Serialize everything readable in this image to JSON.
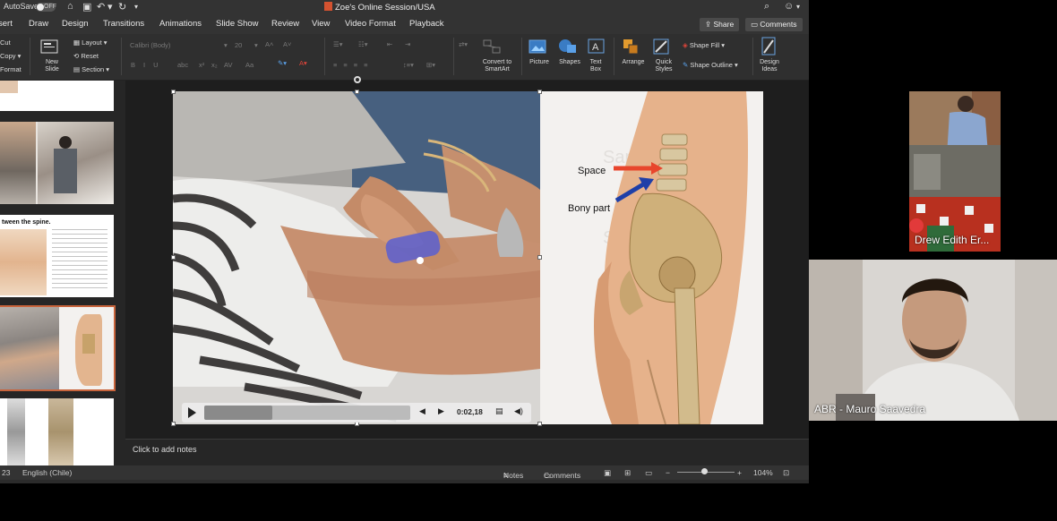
{
  "titlebar": {
    "autosave": "AutoSave",
    "toggle": "OFF",
    "document_title": "Zoe's Online Session/USA"
  },
  "tabs": [
    "sert",
    "Draw",
    "Design",
    "Transitions",
    "Animations",
    "Slide Show",
    "Review",
    "View",
    "Video Format",
    "Playback"
  ],
  "header_buttons": {
    "share": "Share",
    "comments": "Comments"
  },
  "ribbon": {
    "clipboard": {
      "cut": "Cut",
      "copy": "Copy",
      "format": "Format"
    },
    "slides": {
      "new_slide": "New\nSlide",
      "layout": "Layout",
      "reset": "Reset",
      "section": "Section"
    },
    "font": {
      "name": "Calibri (Body)",
      "size": "20"
    },
    "smartart": "Convert to\nSmartArt",
    "insert": {
      "picture": "Picture",
      "shapes": "Shapes",
      "text_box": "Text\nBox"
    },
    "arrange": "Arrange",
    "quick_styles": "Quick\nStyles",
    "shape_fill": "Shape Fill",
    "shape_outline": "Shape Outline",
    "design_ideas": "Design\nIdeas"
  },
  "thumbnails": {
    "slide3_title": "tween the spine."
  },
  "slide": {
    "labels": {
      "space": "Space",
      "bony_part": "Bony part"
    },
    "watermark": "Sample Use",
    "video": {
      "time": "0:02,18",
      "progress": 0.33
    }
  },
  "notes": {
    "placeholder": "Click to add notes"
  },
  "statusbar": {
    "slide": "23",
    "language": "English (Chile)",
    "notes": "Notes",
    "comments": "Comments",
    "zoom": "104%"
  },
  "participants": [
    {
      "name": "Drew Edith Er..."
    },
    {
      "name": "ABR - Mauro Saavedra"
    }
  ],
  "colors": {
    "accent": "#d35230",
    "selection": "#c8643c",
    "arrow_red": "#e8452c",
    "arrow_blue": "#1f3fa8"
  }
}
